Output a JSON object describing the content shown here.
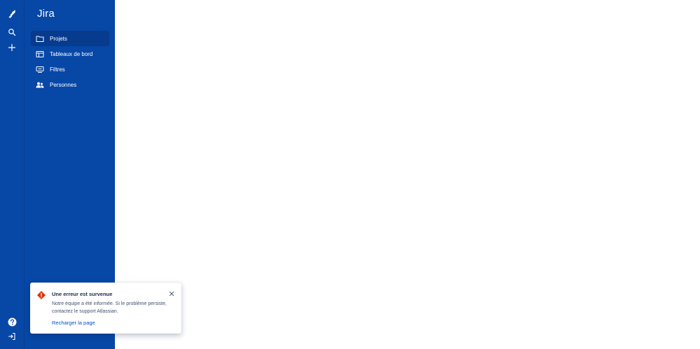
{
  "global_nav": {
    "items": [
      {
        "icon": "jira-logo-icon"
      },
      {
        "icon": "search-icon"
      },
      {
        "icon": "plus-icon"
      }
    ],
    "bottom_items": [
      {
        "icon": "help-icon"
      },
      {
        "icon": "log-in-icon"
      }
    ]
  },
  "sidebar": {
    "title": "Jira",
    "items": [
      {
        "label": "Projets",
        "icon": "folder-icon",
        "active": true
      },
      {
        "label": "Tableaux de bord",
        "icon": "dashboard-icon",
        "active": false
      },
      {
        "label": "Filtres",
        "icon": "filter-icon",
        "active": false
      },
      {
        "label": "Personnes",
        "icon": "people-icon",
        "active": false
      }
    ]
  },
  "flag": {
    "title": "Une erreur est survenue",
    "body": "Notre équipe a été informée. Si le problème persiste, contactez le support Atlassian.",
    "action": "Recharger la page",
    "icon": "error-icon"
  },
  "colors": {
    "nav_bg": "#0747a6",
    "nav_active": "#063b8d",
    "error": "#de350b",
    "link": "#0052cc"
  }
}
